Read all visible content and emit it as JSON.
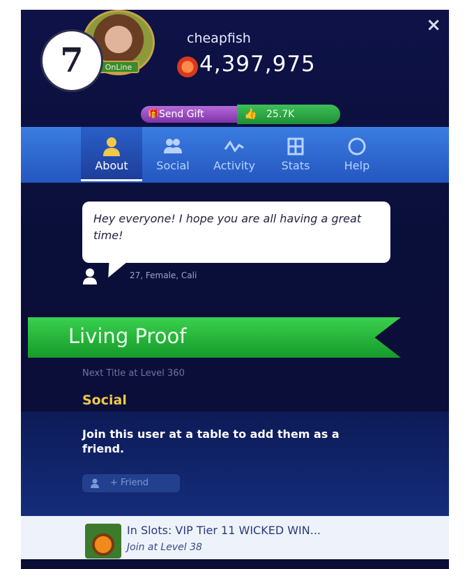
{
  "header": {
    "username": "cheapfish",
    "chips": "4,397,975",
    "online_badge": "OnLine",
    "step_number": "7",
    "close_glyph": "×"
  },
  "actions": {
    "send_gift_label": "Send Gift",
    "likes_label": "25.7K"
  },
  "tabs": [
    {
      "label": "About",
      "icon": "person-icon",
      "active": true
    },
    {
      "label": "Social",
      "icon": "people-icon",
      "active": false
    },
    {
      "label": "Activity",
      "icon": "activity-icon",
      "active": false
    },
    {
      "label": "Stats",
      "icon": "stats-grid-icon",
      "active": false
    },
    {
      "label": "Help",
      "icon": "help-circle-icon",
      "active": false
    }
  ],
  "about": {
    "status_message": "Hey everyone! I hope you are all having a great time!",
    "bio": "27, Female, Cali",
    "title": "Living Proof",
    "next_title": "Next Title at Level 360"
  },
  "social": {
    "heading": "Social",
    "description": "Join this user at a table to add them as a friend.",
    "friend_button": "+ Friend"
  },
  "footer": {
    "slot_title": "In Slots: VIP Tier 11 WICKED WIN...",
    "slot_subtitle": "Join at Level 38"
  },
  "colors": {
    "panel_bg": "#0e1247",
    "tab_bar": "#2f6ad6",
    "ribbon_green": "#25b83c",
    "gift_purple": "#9a4cc8",
    "like_green": "#2aa844",
    "section_gold": "#f0c84a"
  }
}
